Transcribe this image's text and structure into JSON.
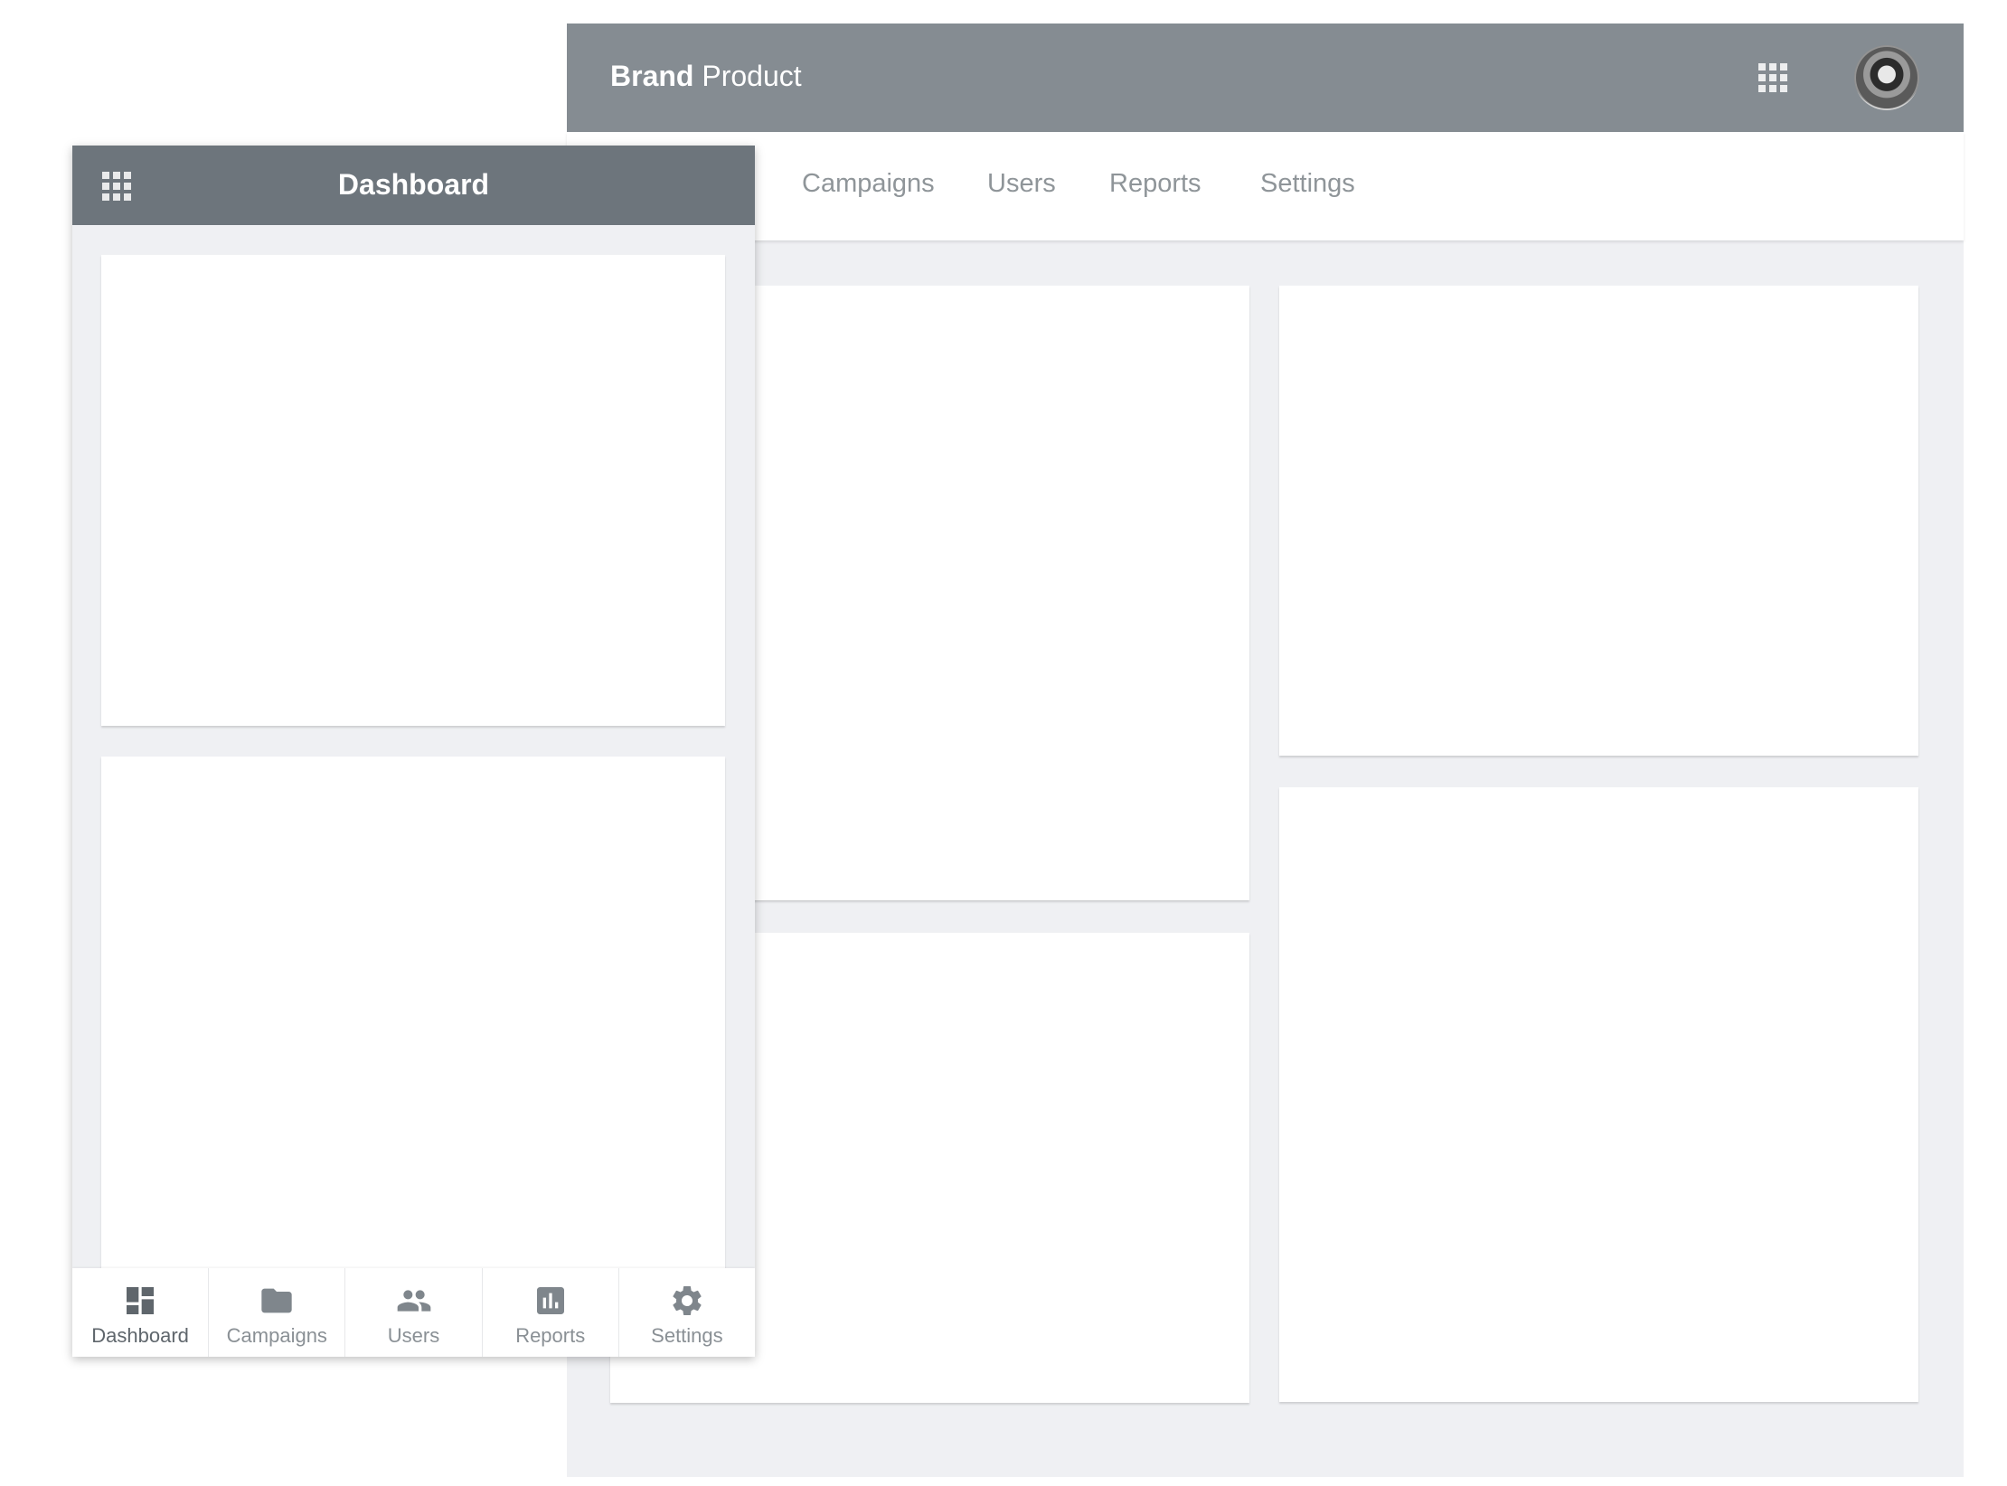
{
  "desktop": {
    "brand": {
      "bold": "Brand",
      "rest": "Product"
    },
    "nav_tabs": [
      {
        "label": "Campaigns"
      },
      {
        "label": "Users"
      },
      {
        "label": "Reports"
      },
      {
        "label": "Settings"
      }
    ],
    "header_icons": [
      "apps-grid-icon",
      "user-avatar"
    ]
  },
  "mobile": {
    "title": "Dashboard",
    "header_icons": [
      "apps-grid-icon"
    ],
    "bottom_nav": [
      {
        "label": "Dashboard",
        "icon": "dashboard-icon",
        "active": true
      },
      {
        "label": "Campaigns",
        "icon": "folder-icon",
        "active": false
      },
      {
        "label": "Users",
        "icon": "people-icon",
        "active": false
      },
      {
        "label": "Reports",
        "icon": "bar-chart-icon",
        "active": false
      },
      {
        "label": "Settings",
        "icon": "gear-icon",
        "active": false
      }
    ]
  },
  "colors": {
    "desktop_header": "#858c92",
    "mobile_header": "#6d757c",
    "page_background": "#eff0f3",
    "nav_text": "#8f9599",
    "icon": "#7f868c",
    "active_icon": "#5f666c"
  }
}
